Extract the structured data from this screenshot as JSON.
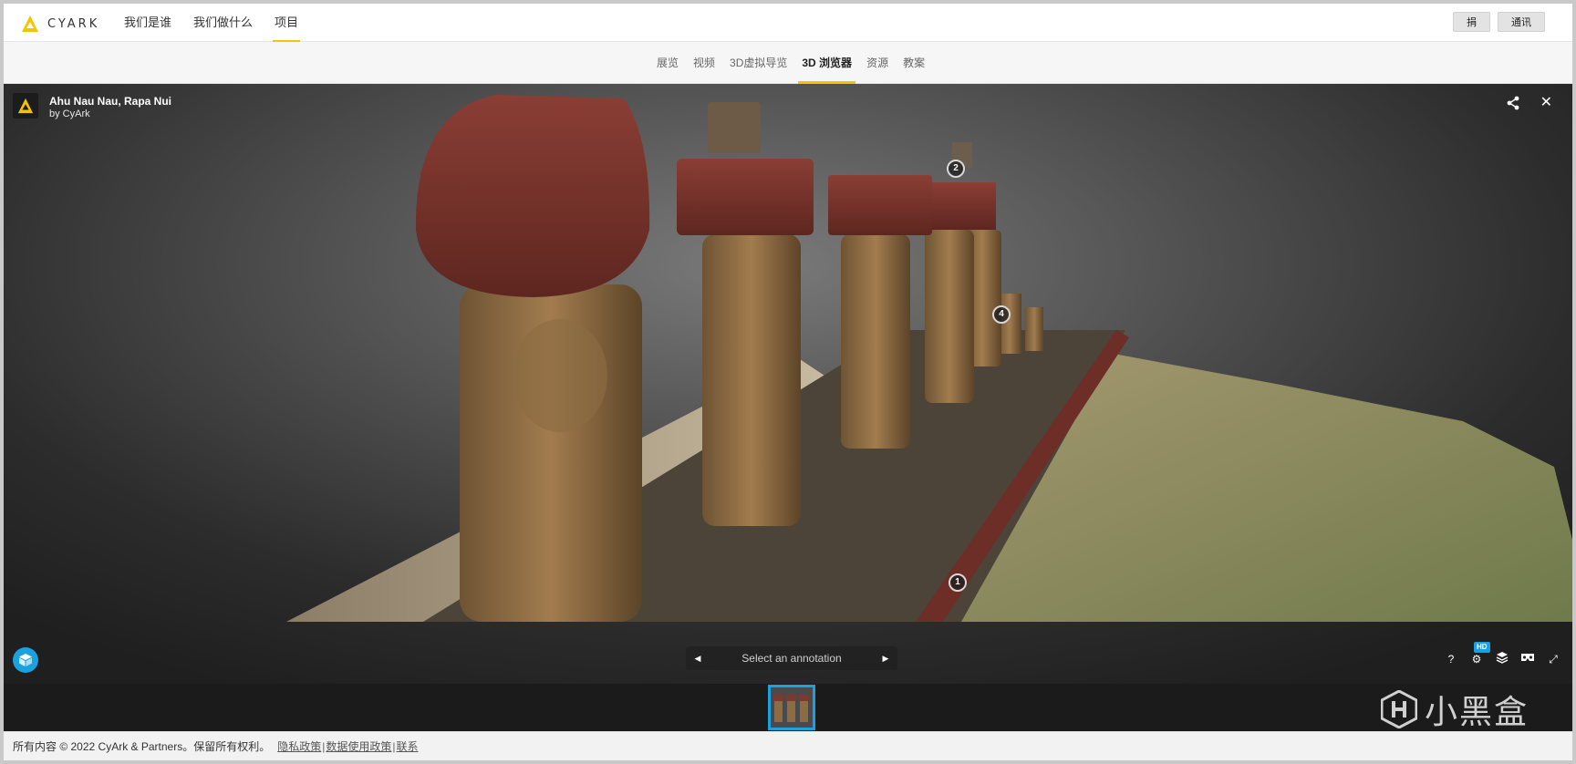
{
  "header": {
    "logo_text": "CYARK",
    "nav": [
      {
        "label": "我们是谁"
      },
      {
        "label": "我们做什么"
      },
      {
        "label": "项目"
      }
    ],
    "buttons": {
      "donate": "捐",
      "newsletter": "通讯"
    }
  },
  "subnav": {
    "items": [
      {
        "label": "展览"
      },
      {
        "label": "视频"
      },
      {
        "label": "3D虚拟导览"
      },
      {
        "label": "3D 浏览器"
      },
      {
        "label": "资源"
      },
      {
        "label": "教案"
      }
    ],
    "active": "3D 浏览器"
  },
  "viewer": {
    "title": "Ahu Nau Nau, Rapa Nui",
    "subtitle": "by CyArk",
    "annotation_prompt": "Select an annotation",
    "pins": [
      "1",
      "2",
      "4"
    ],
    "hd_label": "HD",
    "help_label": "?",
    "icons": [
      "share-icon",
      "close-icon",
      "cube-icon",
      "help-icon",
      "settings-icon",
      "layers-icon",
      "vr-icon",
      "fullscreen-icon"
    ]
  },
  "footer": {
    "copyright": "所有内容 © 2022 CyArk & Partners。保留所有权利。",
    "privacy": "隐私政策",
    "data_policy": "数据使用政策",
    "contact": "联系",
    "separator": "|"
  },
  "watermark": {
    "text": "小黑盒"
  },
  "colors": {
    "accent_yellow": "#f5c400",
    "accent_blue": "#1aa2e0"
  }
}
